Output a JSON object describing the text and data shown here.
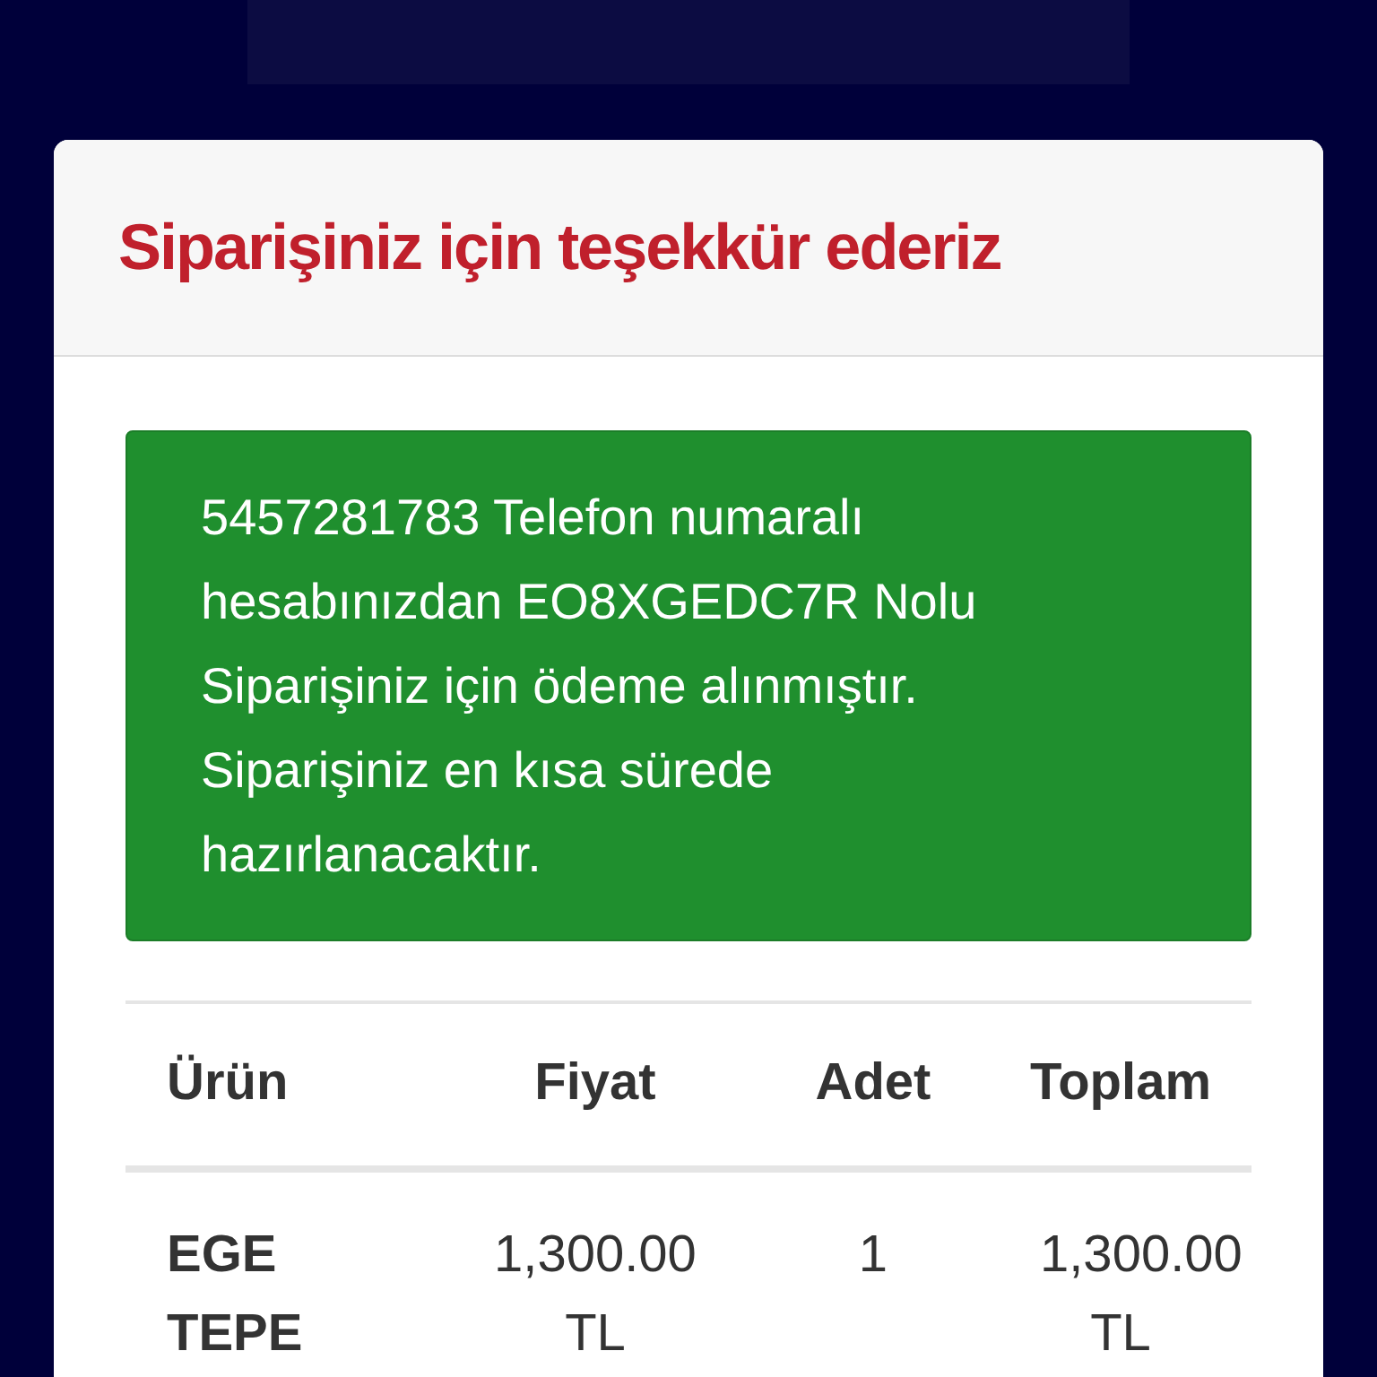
{
  "card": {
    "title": "Siparişiniz için teşekkür ederiz",
    "alert": "5457281783 Telefon numaralı hesabınızdan EO8XGEDC7R Nolu Siparişiniz için ödeme alınmıştır. Siparişiniz en kısa sürede hazırlanacaktır.",
    "table": {
      "columns": [
        "Ürün",
        "Fiyat",
        "Adet",
        "Toplam"
      ],
      "rows": [
        [
          "EGE TEPE",
          "1,300.00 TL",
          "1",
          "1,300.00 TL"
        ]
      ]
    }
  }
}
